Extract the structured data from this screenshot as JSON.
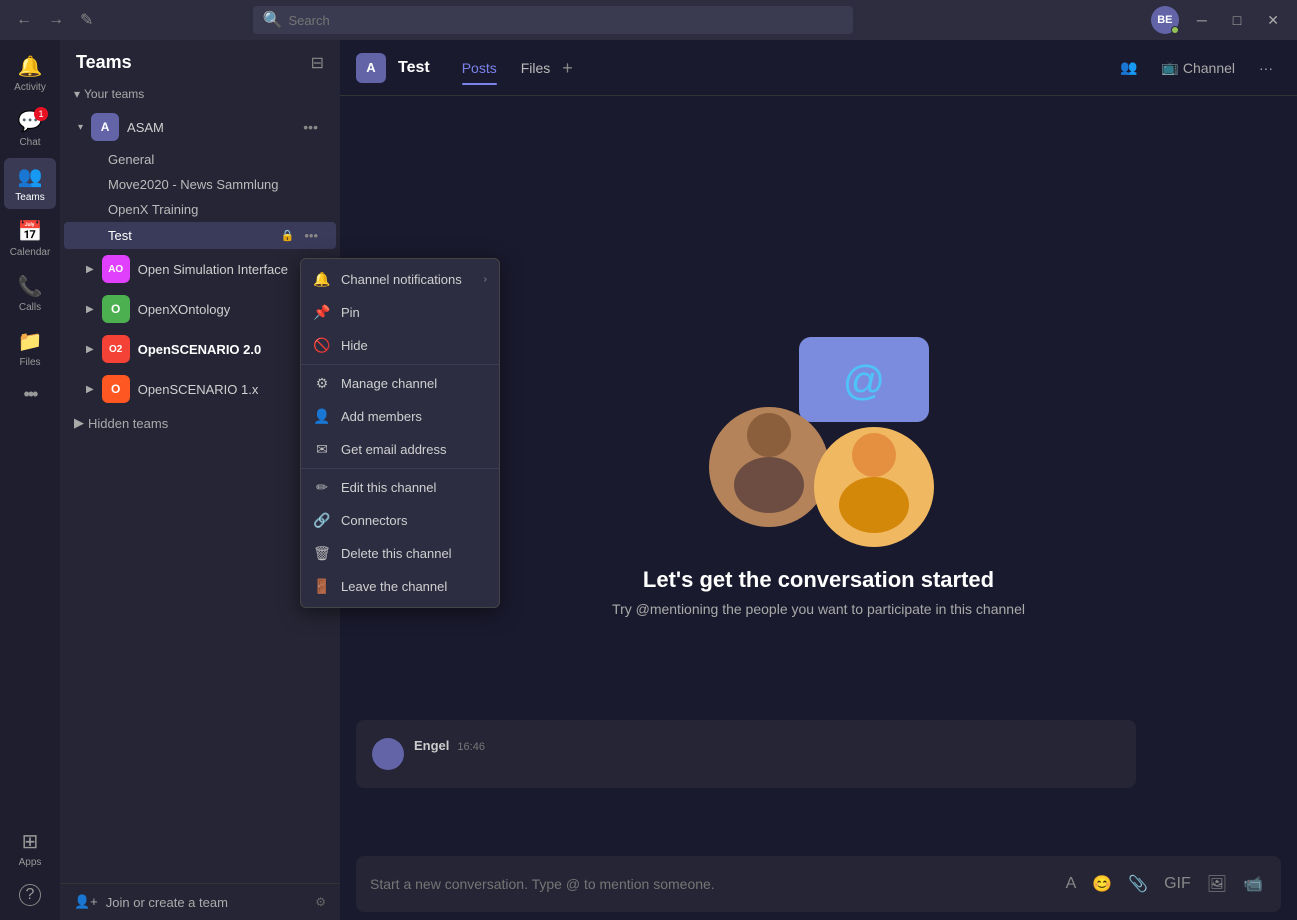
{
  "titlebar": {
    "search_placeholder": "Search",
    "avatar_initials": "BE",
    "back_label": "←",
    "forward_label": "→",
    "edit_label": "✎"
  },
  "sidebar": {
    "title": "Teams",
    "section_your_teams": "Your teams",
    "section_hidden": "Hidden teams",
    "join_create": "Join or create a team",
    "teams": [
      {
        "id": "asam",
        "name": "ASAM",
        "avatar_label": "A",
        "color": "#6264a7",
        "channels": [
          {
            "name": "General",
            "locked": false
          },
          {
            "name": "Move2020 - News Sammlung",
            "locked": false
          },
          {
            "name": "OpenX Training",
            "locked": false
          },
          {
            "name": "Test",
            "locked": true,
            "active": true
          }
        ]
      }
    ],
    "sub_teams": [
      {
        "id": "osi",
        "name": "Open Simulation Interface",
        "avatar_label": "AO",
        "color": "#e040fb"
      },
      {
        "id": "oxo",
        "name": "OpenXOntology",
        "avatar_label": "O",
        "color": "#4caf50"
      },
      {
        "id": "os2",
        "name": "OpenSCENARIO 2.0",
        "avatar_label": "O2",
        "color": "#f44336"
      },
      {
        "id": "os1",
        "name": "OpenSCENARIO 1.x",
        "avatar_label": "O",
        "color": "#ff5722"
      }
    ]
  },
  "channel": {
    "name": "Test",
    "avatar_label": "A",
    "avatar_color": "#6264a7",
    "tabs": [
      {
        "label": "Posts",
        "active": true
      },
      {
        "label": "Files",
        "active": false
      }
    ],
    "add_tab_label": "+",
    "channel_btn_label": "Channel",
    "more_btn_label": "···"
  },
  "context_menu": {
    "items": [
      {
        "id": "channel-notifications",
        "label": "Channel notifications",
        "icon": "🔔",
        "has_arrow": true
      },
      {
        "id": "pin",
        "label": "Pin",
        "icon": "📌",
        "has_arrow": false
      },
      {
        "id": "hide",
        "label": "Hide",
        "icon": "🚫",
        "has_arrow": false
      },
      {
        "id": "divider1",
        "type": "divider"
      },
      {
        "id": "manage-channel",
        "label": "Manage channel",
        "icon": "⚙",
        "has_arrow": false
      },
      {
        "id": "add-members",
        "label": "Add members",
        "icon": "👤",
        "has_arrow": false
      },
      {
        "id": "get-email",
        "label": "Get email address",
        "icon": "✉",
        "has_arrow": false
      },
      {
        "id": "divider2",
        "type": "divider"
      },
      {
        "id": "edit-channel",
        "label": "Edit this channel",
        "icon": "✏",
        "has_arrow": false
      },
      {
        "id": "connectors",
        "label": "Connectors",
        "icon": "🔗",
        "has_arrow": false
      },
      {
        "id": "delete-channel",
        "label": "Delete this channel",
        "icon": "🗑",
        "has_arrow": false
      },
      {
        "id": "leave-channel",
        "label": "Leave the channel",
        "icon": "🚪",
        "has_arrow": false
      }
    ]
  },
  "welcome": {
    "title": "Let's get the conversation started",
    "subtitle": "Try @mentioning the people you want to participate in this channel"
  },
  "message": {
    "author": "Engel",
    "time": "16:46",
    "text": ""
  },
  "compose": {
    "placeholder": "Start a new conversation. Type @ to mention someone."
  },
  "rail": [
    {
      "id": "activity",
      "label": "Activity",
      "icon": "🔔",
      "badge": null
    },
    {
      "id": "chat",
      "label": "Chat",
      "icon": "💬",
      "badge": "1"
    },
    {
      "id": "teams",
      "label": "Teams",
      "icon": "👥",
      "badge": null,
      "active": true
    },
    {
      "id": "calendar",
      "label": "Calendar",
      "icon": "📅",
      "badge": null
    },
    {
      "id": "calls",
      "label": "Calls",
      "icon": "📞",
      "badge": null
    },
    {
      "id": "files",
      "label": "Files",
      "icon": "📁",
      "badge": null
    },
    {
      "id": "more",
      "label": "...",
      "icon": "···",
      "badge": null
    }
  ],
  "rail_bottom": [
    {
      "id": "apps",
      "label": "Apps",
      "icon": "⊞"
    },
    {
      "id": "help",
      "label": "?",
      "icon": "?"
    }
  ]
}
